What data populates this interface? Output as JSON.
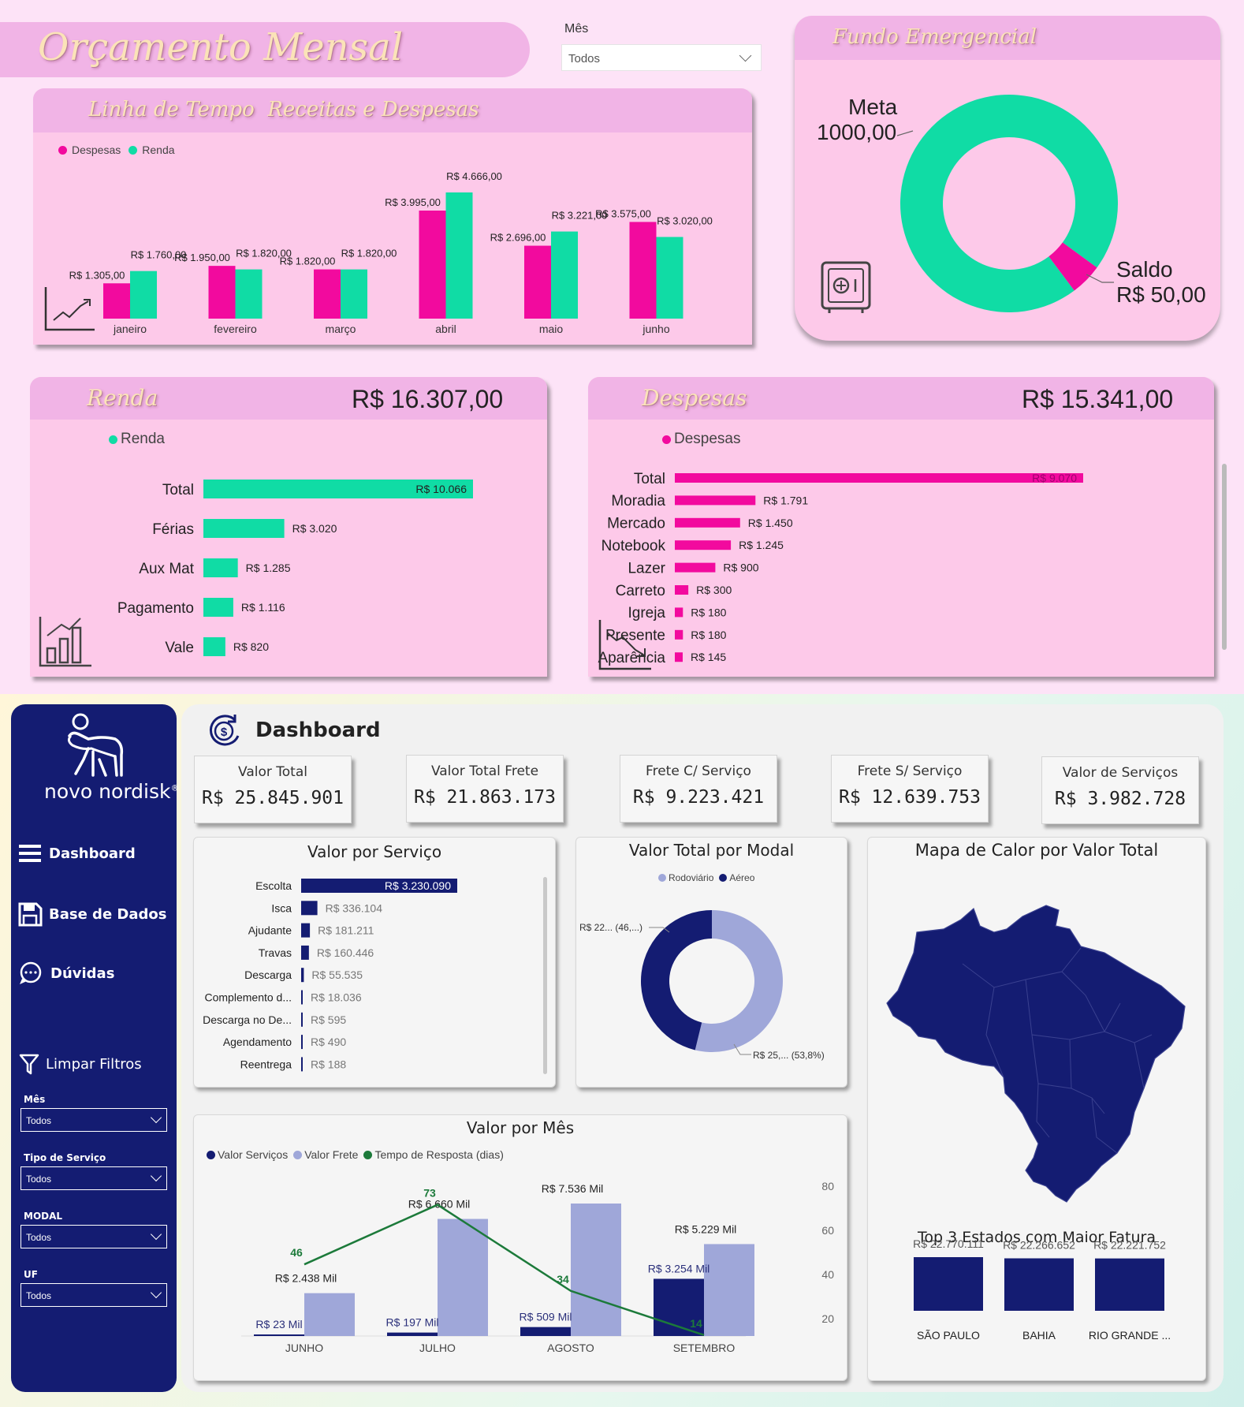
{
  "top": {
    "title": "Orçamento Mensal",
    "month_filter": {
      "label": "Mês",
      "value": "Todos"
    },
    "timeline": {
      "title": "Linha de Tempo  Receitas e Despesas",
      "legend": [
        "Despesas",
        "Renda"
      ],
      "months": [
        {
          "month": "janeiro",
          "despesas": 1305,
          "renda": 1760,
          "despesas_label": "R$ 1.305,00",
          "renda_label": "R$ 1.760,00"
        },
        {
          "month": "fevereiro",
          "despesas": 1950,
          "renda": 1820,
          "despesas_label": "R$ 1.950,00",
          "renda_label": "R$ 1.820,00"
        },
        {
          "month": "março",
          "despesas": 1820,
          "renda": 1820,
          "despesas_label": "R$ 1.820,00",
          "renda_label": "R$ 1.820,00"
        },
        {
          "month": "abril",
          "despesas": 3995,
          "renda": 4666,
          "despesas_label": "R$ 3.995,00",
          "renda_label": "R$ 4.666,00"
        },
        {
          "month": "maio",
          "despesas": 2696,
          "renda": 3221,
          "despesas_label": "R$ 2.696,00",
          "renda_label": "R$ 3.221,00"
        },
        {
          "month": "junho",
          "despesas": 3575,
          "renda": 3020,
          "despesas_label": "R$ 3.575,00",
          "renda_label": "R$ 3.020,00"
        }
      ]
    },
    "emergency": {
      "title": "Fundo Emergencial",
      "meta_label": "Meta",
      "meta_value": "1000,00",
      "saldo_label": "Saldo",
      "saldo_value": "R$ 50,00",
      "meta_amount": 1000,
      "saldo_amount": 50
    },
    "renda": {
      "title": "Renda",
      "total": "R$ 16.307,00",
      "legend": "Renda",
      "rows": [
        {
          "label": "Total",
          "value": 10066,
          "text": "R$ 10.066"
        },
        {
          "label": "Férias",
          "value": 3020,
          "text": "R$ 3.020"
        },
        {
          "label": "Aux Mat",
          "value": 1285,
          "text": "R$ 1.285"
        },
        {
          "label": "Pagamento",
          "value": 1116,
          "text": "R$ 1.116"
        },
        {
          "label": "Vale",
          "value": 820,
          "text": "R$ 820"
        }
      ]
    },
    "despesas": {
      "title": "Despesas",
      "total": "R$ 15.341,00",
      "legend": "Despesas",
      "rows": [
        {
          "label": "Total",
          "value": 9070,
          "text": "R$ 9.070"
        },
        {
          "label": "Moradia",
          "value": 1791,
          "text": "R$ 1.791"
        },
        {
          "label": "Mercado",
          "value": 1450,
          "text": "R$ 1.450"
        },
        {
          "label": "Notebook",
          "value": 1245,
          "text": "R$ 1.245"
        },
        {
          "label": "Lazer",
          "value": 900,
          "text": "R$ 900"
        },
        {
          "label": "Carreto",
          "value": 300,
          "text": "R$ 300"
        },
        {
          "label": "Igreja",
          "value": 180,
          "text": "R$ 180"
        },
        {
          "label": "Presente",
          "value": 180,
          "text": "R$ 180"
        },
        {
          "label": "Aparência",
          "value": 145,
          "text": "R$ 145"
        }
      ]
    }
  },
  "bottom": {
    "brand": "novo nordisk",
    "brand_mark": "®",
    "nav": [
      {
        "label": "Dashboard",
        "icon": "menu-icon"
      },
      {
        "label": "Base de Dados",
        "icon": "save-icon"
      },
      {
        "label": "Dúvidas",
        "icon": "question-icon"
      }
    ],
    "clear_filters": "Limpar Filtros",
    "filters": [
      {
        "label": "Mês",
        "value": "Todos"
      },
      {
        "label": "Tipo de Serviço",
        "value": "Todos"
      },
      {
        "label": "MODAL",
        "value": "Todos"
      },
      {
        "label": "UF",
        "value": "Todos"
      }
    ],
    "page_title": "Dashboard",
    "kpis": [
      {
        "title": "Valor Total",
        "value": "R$ 25.845.901"
      },
      {
        "title": "Valor Total Frete",
        "value": "R$ 21.863.173"
      },
      {
        "title": "Frete C/ Serviço",
        "value": "R$ 9.223.421"
      },
      {
        "title": "Frete S/ Serviço",
        "value": "R$ 12.639.753"
      },
      {
        "title": "Valor de Serviços",
        "value": "R$ 3.982.728"
      }
    ],
    "servico": {
      "title": "Valor por Serviço",
      "rows": [
        {
          "label": "Escolta",
          "value": 3230090,
          "text": "R$ 3.230.090"
        },
        {
          "label": "Isca",
          "value": 336104,
          "text": "R$ 336.104"
        },
        {
          "label": "Ajudante",
          "value": 181211,
          "text": "R$ 181.211"
        },
        {
          "label": "Travas",
          "value": 160446,
          "text": "R$ 160.446"
        },
        {
          "label": "Descarga",
          "value": 55535,
          "text": "R$ 55.535"
        },
        {
          "label": "Complemento d...",
          "value": 18036,
          "text": "R$ 18.036"
        },
        {
          "label": "Descarga no De...",
          "value": 595,
          "text": "R$ 595"
        },
        {
          "label": "Agendamento",
          "value": 490,
          "text": "R$ 490"
        },
        {
          "label": "Reentrega",
          "value": 188,
          "text": "R$ 188"
        }
      ]
    },
    "modal": {
      "title": "Valor Total por Modal",
      "legend": [
        "Rodoviário",
        "Aéreo"
      ],
      "aereo_pct": 46.2,
      "rodoviario_pct": 53.8,
      "aereo_label": "R$ 22... (46,...)",
      "rodoviario_label": "R$ 25,... (53,8%)"
    },
    "mapa": {
      "title": "Mapa de Calor por Valor Total",
      "top3_title": "Top 3 Estados com Maior Fatura",
      "states": [
        {
          "name": "SÃO PAULO",
          "value": 22770111,
          "text": "R$ 22.770.111"
        },
        {
          "name": "BAHIA",
          "value": 22266652,
          "text": "R$ 22.266.652"
        },
        {
          "name": "RIO GRANDE ...",
          "value": 22221752,
          "text": "R$ 22.221.752"
        }
      ]
    },
    "mes": {
      "title": "Valor por Mês",
      "legend": [
        "Valor Serviços",
        "Valor Frete",
        "Tempo de Resposta (dias)"
      ],
      "y2_ticks": [
        "80",
        "60",
        "40",
        "20"
      ],
      "months": [
        {
          "month": "JUNHO",
          "servicos": 23,
          "frete": 2438,
          "tempo": 46,
          "servicos_label": "R$ 23 Mil",
          "frete_label": "R$ 2.438 Mil"
        },
        {
          "month": "JULHO",
          "servicos": 197,
          "frete": 6660,
          "tempo": 73,
          "servicos_label": "R$ 197 Mil",
          "frete_label": "R$ 6.660 Mil"
        },
        {
          "month": "AGOSTO",
          "servicos": 509,
          "frete": 7536,
          "tempo": 34,
          "servicos_label": "R$ 509 Mil",
          "frete_label": "R$ 7.536 Mil"
        },
        {
          "month": "SETEMBRO",
          "servicos": 3254,
          "frete": 5229,
          "tempo": 14,
          "servicos_label": "R$ 3.254 Mil",
          "frete_label": "R$ 5.229 Mil"
        }
      ]
    },
    "colors": {
      "navy": "#141c72",
      "lavender": "#9fa7d9",
      "green": "#1c7a3a",
      "pink": "#f20a9e",
      "teal": "#10dca5"
    }
  },
  "chart_data": [
    {
      "type": "bar",
      "title": "Linha de Tempo  Receitas e Despesas",
      "categories": [
        "janeiro",
        "fevereiro",
        "março",
        "abril",
        "maio",
        "junho"
      ],
      "series": [
        {
          "name": "Despesas",
          "values": [
            1305,
            1950,
            1820,
            3995,
            2696,
            3575
          ]
        },
        {
          "name": "Renda",
          "values": [
            1760,
            1820,
            1820,
            4666,
            3221,
            3020
          ]
        }
      ]
    },
    {
      "type": "pie",
      "title": "Fundo Emergencial",
      "categories": [
        "Meta",
        "Saldo"
      ],
      "values": [
        1000,
        50
      ]
    },
    {
      "type": "bar",
      "title": "Renda",
      "categories": [
        "Total",
        "Férias",
        "Aux Mat",
        "Pagamento",
        "Vale"
      ],
      "values": [
        10066,
        3020,
        1285,
        1116,
        820
      ]
    },
    {
      "type": "bar",
      "title": "Despesas",
      "categories": [
        "Total",
        "Moradia",
        "Mercado",
        "Notebook",
        "Lazer",
        "Carreto",
        "Igreja",
        "Presente",
        "Aparência"
      ],
      "values": [
        9070,
        1791,
        1450,
        1245,
        900,
        300,
        180,
        180,
        145
      ]
    },
    {
      "type": "bar",
      "title": "Valor por Serviço",
      "categories": [
        "Escolta",
        "Isca",
        "Ajudante",
        "Travas",
        "Descarga",
        "Complemento d...",
        "Descarga no De...",
        "Agendamento",
        "Reentrega"
      ],
      "values": [
        3230090,
        336104,
        181211,
        160446,
        55535,
        18036,
        595,
        490,
        188
      ]
    },
    {
      "type": "pie",
      "title": "Valor Total por Modal",
      "categories": [
        "Rodoviário",
        "Aéreo"
      ],
      "values": [
        53.8,
        46.2
      ]
    },
    {
      "type": "bar",
      "title": "Valor por Mês",
      "categories": [
        "JUNHO",
        "JULHO",
        "AGOSTO",
        "SETEMBRO"
      ],
      "series": [
        {
          "name": "Valor Serviços",
          "values": [
            23,
            197,
            509,
            3254
          ]
        },
        {
          "name": "Valor Frete",
          "values": [
            2438,
            6660,
            7536,
            5229
          ]
        },
        {
          "name": "Tempo de Resposta (dias)",
          "values": [
            46,
            73,
            34,
            14
          ]
        }
      ],
      "y2_ticks": [
        80,
        60,
        40,
        20
      ]
    },
    {
      "type": "bar",
      "title": "Top 3 Estados com Maior Fatura",
      "categories": [
        "SÃO PAULO",
        "BAHIA",
        "RIO GRANDE ..."
      ],
      "values": [
        22770111,
        22266652,
        22221752
      ]
    }
  ]
}
